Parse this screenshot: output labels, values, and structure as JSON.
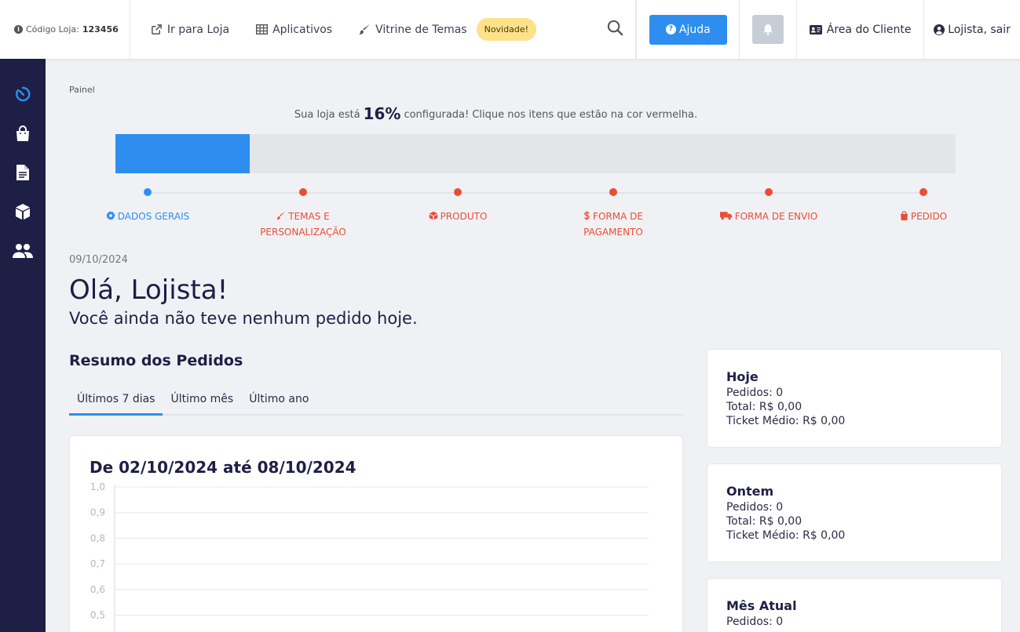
{
  "topbar": {
    "store_code_label": "Código Loja:",
    "store_code_value": "123456",
    "nav": [
      {
        "label": "Ir para Loja",
        "icon": "external-link-icon"
      },
      {
        "label": "Aplicativos",
        "icon": "grid-icon"
      },
      {
        "label": "Vitrine de Temas",
        "icon": "brush-icon"
      }
    ],
    "new_badge": "Novidade!",
    "help_label": "Ajuda",
    "client_area_label": "Área do Cliente",
    "user_label": "Lojista, sair"
  },
  "sidebar": {
    "items": [
      {
        "icon": "dashboard-icon"
      },
      {
        "icon": "shopping-bag-icon"
      },
      {
        "icon": "document-icon"
      },
      {
        "icon": "box-icon"
      },
      {
        "icon": "users-icon"
      }
    ]
  },
  "main": {
    "breadcrumb": "Painel",
    "progress": {
      "prefix": "Sua loja está",
      "percent_label": "16%",
      "percent_value": 16,
      "suffix": "configurada! Clique nos itens que estão na cor vermelha."
    },
    "steps": [
      {
        "line1": "DADOS GERAIS",
        "line2": "",
        "done": true,
        "icon": "gear-icon"
      },
      {
        "line1": "TEMAS E",
        "line2": "PERSONALIZAÇÃO",
        "done": false,
        "icon": "brush-icon"
      },
      {
        "line1": "PRODUTO",
        "line2": "",
        "done": false,
        "icon": "cube-icon"
      },
      {
        "line1": "FORMA DE",
        "line2": "PAGAMENTO",
        "done": false,
        "icon": "dollar-icon"
      },
      {
        "line1": "FORMA DE ENVIO",
        "line2": "",
        "done": false,
        "icon": "truck-icon"
      },
      {
        "line1": "PEDIDO",
        "line2": "",
        "done": false,
        "icon": "bag-icon"
      }
    ],
    "date": "09/10/2024",
    "greeting": "Olá, Lojista!",
    "subgreeting": "Você ainda não teve nenhum pedido hoje.",
    "orders_title": "Resumo dos Pedidos",
    "tabs": [
      "Últimos 7 dias",
      "Último mês",
      "Último ano"
    ],
    "active_tab": 0,
    "chart_title": "De 02/10/2024 até 08/10/2024"
  },
  "chart_data": {
    "type": "bar",
    "title": "De 02/10/2024 até 08/10/2024",
    "categories": [],
    "values": [],
    "yticks": [
      "1,0",
      "0,9",
      "0,8",
      "0,7",
      "0,6",
      "0,5"
    ],
    "ylim": [
      0,
      1
    ],
    "grid": true
  },
  "stats": [
    {
      "title": "Hoje",
      "orders": "Pedidos: 0",
      "total": "Total: R$ 0,00",
      "ticket": "Ticket Médio: R$ 0,00"
    },
    {
      "title": "Ontem",
      "orders": "Pedidos: 0",
      "total": "Total: R$ 0,00",
      "ticket": "Ticket Médio: R$ 0,00"
    },
    {
      "title": "Mês Atual",
      "orders": "Pedidos: 0",
      "total": "",
      "ticket": ""
    }
  ],
  "colors": {
    "accent": "#2d8ef0",
    "sidebar": "#1e1f45",
    "pending": "#e94e35",
    "badge": "#fde28a"
  }
}
